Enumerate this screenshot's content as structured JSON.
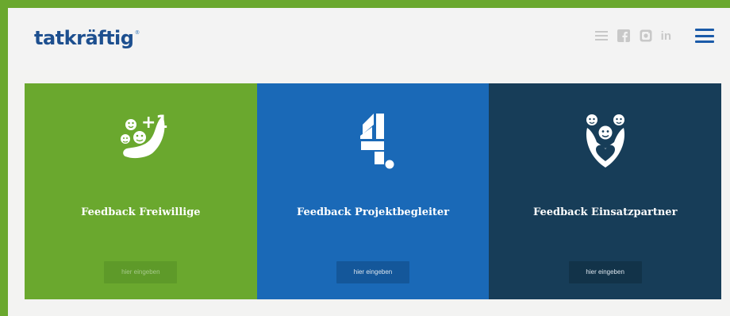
{
  "header": {
    "logo": "tatkräftig",
    "logo_mark": "®",
    "social_icons": [
      "list-icon",
      "facebook-icon",
      "instagram-icon",
      "linkedin-icon"
    ],
    "linkedin_text": "in",
    "menu_icon": "hamburger-menu-icon"
  },
  "panels": [
    {
      "title": "Feedback Freiwillige",
      "button": "hier eingeben",
      "icon": "volunteer-plus-one-icon",
      "color": "#6aa82e"
    },
    {
      "title": "Feedback Projektbegleiter",
      "button": "hier eingeben",
      "icon": "puzzle-four-icon",
      "color": "#1a69b7"
    },
    {
      "title": "Feedback Einsatzpartner",
      "button": "hier eingeben",
      "icon": "people-heart-icon",
      "color": "#173d58"
    }
  ]
}
